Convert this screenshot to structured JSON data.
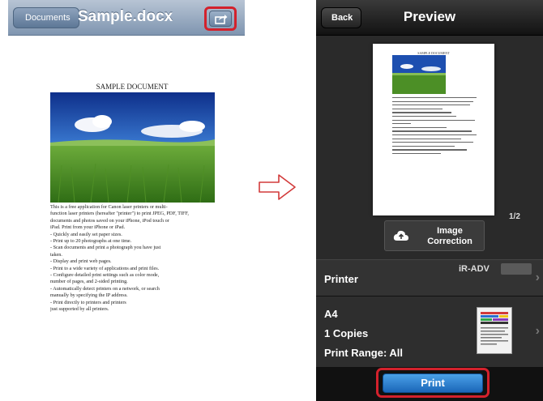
{
  "left_screen": {
    "nav": {
      "back_label": "Documents",
      "title": "Sample.docx",
      "share_icon": "share-icon"
    },
    "document": {
      "heading": "SAMPLE DOCUMENT",
      "body_lines": [
        "This is a free application for Canon laser printers or multi-",
        "function laser printers (hereafter \"printer\") to print JPEG, PDF, TIFF,",
        "documents and photos saved on your iPhone, iPod touch or",
        "iPad. Print from your iPhone or iPad.",
        "- Quickly and easily set paper sizes.",
        "- Print up to 20 photographs at one time.",
        "- Scan documents and print a photograph you have just",
        "taken.",
        "- Display and print web pages.",
        "- Print to a wide variety of applications and print files.",
        "- Configure detailed print settings such as color mode,",
        "number of pages, and 2-sided printing.",
        "- Automatically detect printers on a network, or search",
        "manually by specifying the IP address.",
        "- Print directly to printers and printers",
        "just supported by all printers."
      ]
    }
  },
  "arrow_icon": "right-arrow-icon",
  "right_screen": {
    "nav": {
      "back_label": "Back",
      "title": "Preview"
    },
    "preview": {
      "page_indicator": "1/2",
      "image_correction_label": "Image Correction",
      "image_correction_icon": "cloud-upload-icon"
    },
    "printer": {
      "label": "Printer",
      "value": "iR-ADV"
    },
    "settings": {
      "paper_size": "A4",
      "copies": "1 Copies",
      "print_range": "Print Range: All"
    },
    "print_label": "Print"
  },
  "colors": {
    "highlight": "#d3212c",
    "print_button": "#2a7fd2",
    "left_nav": "#8fa3bd",
    "right_background": "#1c1c1c"
  }
}
